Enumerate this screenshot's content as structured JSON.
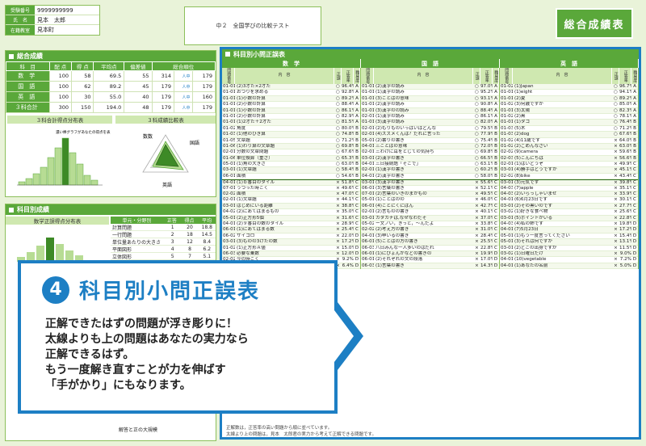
{
  "header": {
    "info": [
      {
        "k": "受験番号",
        "v": "9999999999"
      },
      {
        "k": "氏　名",
        "v": "見本　太郎"
      },
      {
        "k": "在籍教室",
        "v": "見本町"
      }
    ],
    "test_title": "中２　全国学びの比較テスト",
    "badge": "総合成績表"
  },
  "summary": {
    "title": "総合成績",
    "headers": [
      "科　目",
      "配 点",
      "得 点",
      "平均点",
      "偏差値",
      "総合順位"
    ],
    "rows": [
      {
        "subj": "数　学",
        "max": "100",
        "score": "58",
        "avg": "69.5",
        "dev": "55",
        "rank": "314",
        "of": "人中",
        "n": "179"
      },
      {
        "subj": "国　語",
        "max": "100",
        "score": "62",
        "avg": "89.2",
        "dev": "45",
        "rank": "179",
        "of": "人中",
        "n": "179"
      },
      {
        "subj": "英　語",
        "max": "100",
        "score": "30",
        "avg": "55.0",
        "dev": "40",
        "rank": "179",
        "of": "人中",
        "n": "160"
      },
      {
        "subj": "３科合計",
        "max": "300",
        "score": "150",
        "avg": "194.0",
        "dev": "48",
        "rank": "179",
        "of": "人中",
        "n": "179"
      }
    ],
    "dist_title": "３科合計得点分布表",
    "compare_title": "３科成績比較表",
    "radar_labels": [
      "数数",
      "国語",
      "英語"
    ],
    "legend": [
      "平均点",
      "あなたの得点"
    ],
    "dist_note": "濃い棒グラフがあなたの得点を表しています。"
  },
  "subject": {
    "title": "科目別成績",
    "sub": "数学正誤得点分布表",
    "table_head": [
      "単元・分野別",
      "正答",
      "得点",
      "平均"
    ],
    "items": [
      "計算問題",
      "一行問題",
      "単位量あたりの大きさ",
      "平面図形",
      "立体図形"
    ],
    "vals": [
      [
        "1",
        "20",
        "18.8"
      ],
      [
        "2",
        "18",
        "14.5"
      ],
      [
        "3",
        "12",
        "8.4"
      ],
      [
        "4",
        "8",
        "6.2"
      ],
      [
        "5",
        "7",
        "5.1"
      ]
    ],
    "bottom": "解答と正の大規模"
  },
  "grid": {
    "title": "科目別小問正誤表",
    "subjects": [
      "数　学",
      "国　語",
      "英　語"
    ],
    "col_head": [
      "問題番号",
      "内　容",
      "正誤",
      "正答率",
      "難易度"
    ],
    "math": [
      [
        "01-01",
        "(2)3才た×2才た",
        "○",
        "96.4%",
        "A"
      ],
      [
        "01-01",
        "おつりを求める",
        "○",
        "92.8%",
        "A"
      ],
      [
        "01-01",
        "(1)小数の計算",
        "○",
        "89.2%",
        "A"
      ],
      [
        "01-01",
        "(2)小数の計算",
        "○",
        "88.4%",
        "A"
      ],
      [
        "01-01",
        "(1)小数の計算",
        "○",
        "86.1%",
        "A"
      ],
      [
        "01-01",
        "(2)小数の計算",
        "○",
        "82.9%",
        "A"
      ],
      [
        "01-01",
        "(1)2才た＋2才た",
        "○",
        "81.5%",
        "A"
      ],
      [
        "01-02",
        "角度",
        "○",
        "80.0%",
        "B"
      ],
      [
        "01-03",
        "(1)他のひき算",
        "○",
        "74.8%",
        "B"
      ],
      [
        "01-05",
        "文章題",
        "○",
        "71.2%",
        "B"
      ],
      [
        "01-06",
        "(1)わり算の文章題",
        "○",
        "69.8%",
        "B"
      ],
      [
        "02-01",
        "分数の文章問題",
        "○",
        "67.6%",
        "B"
      ],
      [
        "01-06",
        "単位換算（重さ）",
        "○",
        "65.3%",
        "B"
      ],
      [
        "05-01",
        "(1)角の大きさ",
        "○",
        "63.0%",
        "B"
      ],
      [
        "03-01",
        "(1)文章題",
        "○",
        "58.4%",
        "B"
      ],
      [
        "06-01",
        "面積",
        "○",
        "54.6%",
        "B"
      ],
      [
        "04-01",
        "(1)ｂ番目のタイル",
        "×",
        "51.8%",
        "C"
      ],
      [
        "07-01",
        "うつった時こく",
        "×",
        "49.6%",
        "C"
      ],
      [
        "02-02",
        "面積",
        "×",
        "47.0%",
        "C"
      ],
      [
        "02-01",
        "(1)文章題",
        "×",
        "44.1%",
        "C"
      ],
      [
        "03-01",
        "はじめにいる距離",
        "×",
        "38.8%",
        "C"
      ],
      [
        "04-02",
        "(2)にあてはまるもの",
        "×",
        "35.0%",
        "C"
      ],
      [
        "05-01",
        "(2)正方形5個",
        "×",
        "31.6%",
        "C"
      ],
      [
        "04-01",
        "(2)９番目の数のタイル",
        "×",
        "28.9%",
        "C"
      ],
      [
        "06-01",
        "(1)にあてはまる数",
        "×",
        "25.4%",
        "C"
      ],
      [
        "06-02",
        "サイコロ",
        "×",
        "22.0%",
        "D"
      ],
      [
        "03-01",
        "(3)ものの3けたの数",
        "×",
        "17.2%",
        "D"
      ],
      [
        "01-02",
        "(1)正方形Ａ値",
        "×",
        "15.0%",
        "D"
      ],
      [
        "06-03",
        "必要な乗数",
        "×",
        "12.0%",
        "D"
      ],
      [
        "02-02",
        "今の時こく",
        "×",
        "9.2%",
        "D"
      ],
      [
        "07-03",
        "同じになる時こく",
        "×",
        "6.4%",
        "D"
      ]
    ],
    "japanese": [
      [
        "01-01",
        "(2)漢字の読み",
        "○",
        "97.0%",
        "A"
      ],
      [
        "01-01",
        "(1)漢字の読み",
        "○",
        "95.2%",
        "A"
      ],
      [
        "01-01",
        "(3)ことばの意味",
        "○",
        "93.1%",
        "A"
      ],
      [
        "01-01",
        "(2)漢字の読み",
        "○",
        "90.8%",
        "A"
      ],
      [
        "01-01",
        "(3)漢字のの読み",
        "○",
        "88.4%",
        "A"
      ],
      [
        "02-01",
        "(1)漢字の読み",
        "○",
        "86.1%",
        "A"
      ],
      [
        "01-01",
        "(3)漢字の読み",
        "○",
        "82.0%",
        "A"
      ],
      [
        "02-01",
        "(2)もりものいっばいはどんな",
        "○",
        "79.5%",
        "B"
      ],
      [
        "02-01",
        "(4)ズズメくんは？だれに言った",
        "○",
        "77.9%",
        "B"
      ],
      [
        "05-01",
        "(2)書りの書き",
        "○",
        "75.4%",
        "B"
      ],
      [
        "04-01",
        "三ことばの意味",
        "○",
        "72.0%",
        "B"
      ],
      [
        "02-01",
        "三わけに耳をとじての気持ち",
        "○",
        "69.8%",
        "B"
      ],
      [
        "03-01",
        "(2)漢字の書き",
        "○",
        "66.5%",
        "B"
      ],
      [
        "04-01",
        "三日接続語「そこで」",
        "○",
        "63.1%",
        "B"
      ],
      [
        "02-01",
        "(1)漢字の書き",
        "○",
        "60.2%",
        "B"
      ],
      [
        "04-01",
        "(2)漢字の書き",
        "○",
        "58.0%",
        "B"
      ],
      [
        "03-01",
        "(3)漢字の書き",
        "×",
        "55.6%",
        "C"
      ],
      [
        "06-01",
        "(3)言葉の書き",
        "×",
        "52.1%",
        "C"
      ],
      [
        "07-01",
        "(2)言葉のいきのまかもの",
        "×",
        "49.5%",
        "C"
      ],
      [
        "05-01",
        "(1)ことばのの",
        "×",
        "46.0%",
        "C"
      ],
      [
        "06-01",
        "(4)ことにくにばん",
        "×",
        "42.7%",
        "C"
      ],
      [
        "02-01",
        "(2)言ものの書き",
        "×",
        "40.1%",
        "C"
      ],
      [
        "03-01",
        "カタカナは,なぜなわだそ",
        "×",
        "37.0%",
        "C"
      ],
      [
        "05-02",
        "ー文ノい，きっと，～んだよ",
        "×",
        "33.8%",
        "C"
      ],
      [
        "02-02",
        "(2)考え方の書き",
        "×",
        "31.0%",
        "C"
      ],
      [
        "04-01",
        "(3)申いるの書き",
        "×",
        "28.4%",
        "C"
      ],
      [
        "06-01",
        "(5)ことばの方の書き",
        "×",
        "25.5%",
        "C"
      ],
      [
        "06-03",
        "八日みんな一人多いのはだれ",
        "×",
        "22.8%",
        "C"
      ],
      [
        "06-01",
        "(1)にぴょんかなどの書きの",
        "×",
        "19.9%",
        "D"
      ],
      [
        "06-01",
        "(2)それぞれの文の段落",
        "×",
        "17.0%",
        "D"
      ],
      [
        "06-03",
        "(1)言葉の書き",
        "×",
        "14.3%",
        "D"
      ]
    ],
    "english": [
      [
        "01-02",
        "(1)Japan",
        "○",
        "96.7%",
        "A"
      ],
      [
        "01-01",
        "(1)eight",
        "○",
        "94.1%",
        "A"
      ],
      [
        "01-01",
        "(2)夏",
        "○",
        "89.2%",
        "A"
      ],
      [
        "01-02",
        "(3)何歳ですか",
        "○",
        "85.0%",
        "A"
      ],
      [
        "01-01",
        "(3)太陽",
        "○",
        "82.3%",
        "A"
      ],
      [
        "01-02",
        "(2)黒",
        "○",
        "78.1%",
        "A"
      ],
      [
        "01-01",
        "(1)タコ",
        "○",
        "76.4%",
        "B"
      ],
      [
        "01-03",
        "(5)木",
        "○",
        "71.2%",
        "B"
      ],
      [
        "01-03",
        "(2)dog",
        "○",
        "67.6%",
        "B"
      ],
      [
        "01-02",
        "(4)11歳です",
        "×",
        "64.0%",
        "B"
      ],
      [
        "01-02",
        "(2)ごめんなさい",
        "×",
        "63.0%",
        "B"
      ],
      [
        "02-02",
        "(9)camera",
        "×",
        "59.6%",
        "B"
      ],
      [
        "02-03",
        "(5)こんにちは",
        "×",
        "56.6%",
        "B"
      ],
      [
        "02-01",
        "(1)はいどうぞ",
        "×",
        "49.9%",
        "C"
      ],
      [
        "03-01",
        "(4)勝手はどうですか",
        "×",
        "45.1%",
        "C"
      ],
      [
        "02-02",
        "(8)bike",
        "×",
        "43.4%",
        "C"
      ],
      [
        "03-01",
        "(3)元気です",
        "×",
        "39.8%",
        "C"
      ],
      [
        "04-03",
        "(7)apple",
        "×",
        "35.1%",
        "C"
      ],
      [
        "04-03",
        "(2)いらっしゃいませ",
        "×",
        "33.9%",
        "C"
      ],
      [
        "04-01",
        "(6)6月23日です",
        "×",
        "30.1%",
        "C"
      ],
      [
        "03-01",
        "(2)その黒いのです",
        "×",
        "27.7%",
        "C"
      ],
      [
        "03-02",
        "(1)好きな食べ物",
        "×",
        "25.6%",
        "C"
      ],
      [
        "03-01",
        "(5)ポイントがいる",
        "×",
        "22.8%",
        "C"
      ],
      [
        "04-03",
        "(4)私の姉です",
        "×",
        "19.8%",
        "D"
      ],
      [
        "04-01",
        "(7)5月23日",
        "×",
        "17.2%",
        "D"
      ],
      [
        "05-01",
        "(1)もう一度言ってください",
        "×",
        "15.4%",
        "D"
      ],
      [
        "05-01",
        "(3)それは何ですか",
        "×",
        "13.1%",
        "D"
      ],
      [
        "03-01",
        "(2)どこの出身ですか",
        "×",
        "11.5%",
        "D"
      ],
      [
        "03-02",
        "(1)日曜日だけ",
        "×",
        "9.0%",
        "D"
      ],
      [
        "04-01",
        "(10)vegetable",
        "×",
        "7.2%",
        "D"
      ],
      [
        "04-01",
        "(1)あなたの名前",
        "×",
        "5.0%",
        "D"
      ]
    ],
    "footnote": [
      "正解数は，正答率の高い問題から順に並べています。",
      "太線より上の問題は，見本　太郎君の実力から考えて正解できる問題です。"
    ]
  },
  "callout": {
    "number": "4",
    "title": "科目別小問正誤表",
    "lines": [
      "正解できたはずの問題が浮き彫りに！",
      "太線よりも上の問題はあなたの実力なら",
      "正解できるはず。",
      "もう一度解き直すことが力を伸ばす",
      "「手がかり」にもなります。"
    ]
  }
}
